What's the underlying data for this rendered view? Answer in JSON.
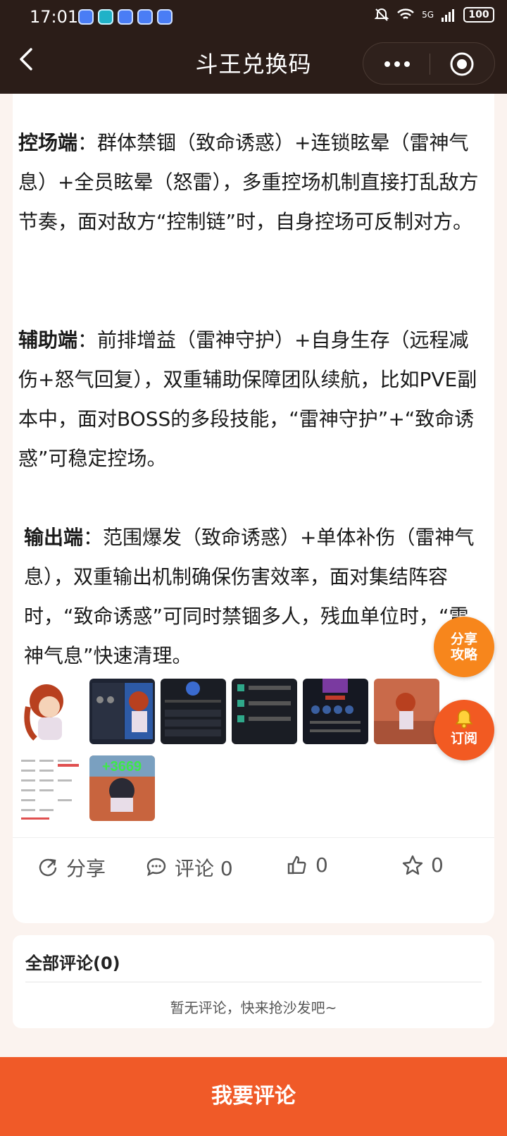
{
  "status_bar": {
    "time": "17:01",
    "network": "5G",
    "battery": "100"
  },
  "header": {
    "title": "斗王兑换码"
  },
  "article": {
    "paragraphs": [
      {
        "label": "控场端",
        "text": "：群体禁锢（致命诱惑）+连锁眩晕（雷神气息）+全员眩晕（怒雷），多重控场机制直接打乱敌方节奏，面对敌方“控制链”时，自身控场可反制对方。"
      },
      {
        "label": "辅助端",
        "text": "：前排增益（雷神守护）+自身生存（远程减伤+怒气回复），双重辅助保障团队续航，比如PVE副本中，面对BOSS的多段技能，“雷神守护”+“致命诱惑”可稳定控场。"
      },
      {
        "label": "输出端",
        "text": "：范围爆发（致命诱惑）+单体补伤（雷神气息），双重输出机制确保伤害效率，面对集结阵容时，“致命诱惑”可同时禁锢多人，残血单位时，“雷神气息”快速清理。"
      }
    ],
    "thumb_overlay_text": "+3669"
  },
  "actions": {
    "share": "分享",
    "comment": "评论 0",
    "like": "0",
    "favorite": "0"
  },
  "floating": {
    "share_line1": "分享",
    "share_line2": "攻略",
    "subscribe": "订阅"
  },
  "comments": {
    "header": "全部评论(0)",
    "empty": "暂无评论，快来抢沙发吧~"
  },
  "bottom_button": "我要评论",
  "colors": {
    "header_bg": "#2b1d18",
    "accent": "#f05a28",
    "page_bg": "#fbf3ef"
  }
}
